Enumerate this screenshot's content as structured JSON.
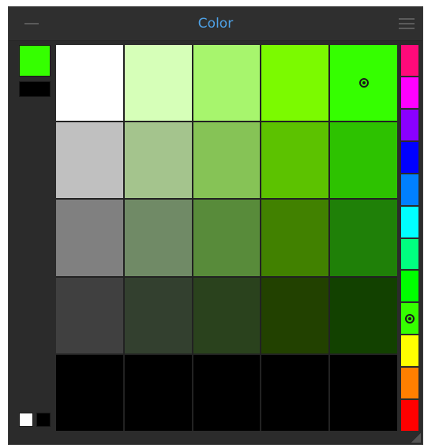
{
  "panel": {
    "title": "Color",
    "icons": {
      "minimize": "minimize-icon",
      "menu": "menu-icon"
    }
  },
  "current_colors": {
    "foreground": "#35ff00",
    "background": "#000000",
    "default_white": "#ffffff",
    "default_black": "#000000"
  },
  "palette": {
    "rows": [
      [
        "#ffffff",
        "#d6ffb8",
        "#a7f56d",
        "#7bfa00",
        "#35ff00"
      ],
      [
        "#c0c0c0",
        "#a4c48d",
        "#86c356",
        "#5cc200",
        "#2dc200"
      ],
      [
        "#808080",
        "#708a66",
        "#588b3a",
        "#418100",
        "#1f8008"
      ],
      [
        "#404040",
        "#33402f",
        "#2a421d",
        "#224100",
        "#124100"
      ],
      [
        "#000000",
        "#000000",
        "#000000",
        "#000000",
        "#000000"
      ]
    ],
    "selected": {
      "row": 0,
      "col": 4
    }
  },
  "hue_strip": {
    "colors": [
      "#ff0a7a",
      "#ff00ff",
      "#8a00ff",
      "#0000ff",
      "#0080ff",
      "#00ffff",
      "#00ff80",
      "#00ff00",
      "#35ff00",
      "#ffff00",
      "#ff7f00",
      "#ff0000"
    ],
    "selected_index": 8
  }
}
